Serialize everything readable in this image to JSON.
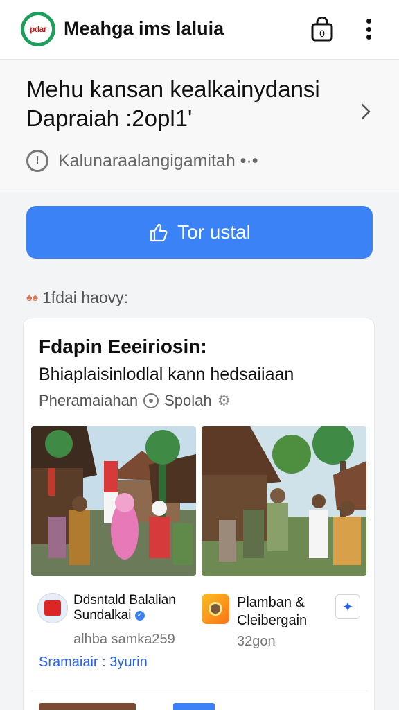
{
  "header": {
    "logo_text": "pdar",
    "title": "Meahga ims laluia",
    "bag_badge": "0"
  },
  "banner": {
    "title": "Mehu kansan kealkainydansi Dapraiah :2opl1'",
    "subtitle": "Kalunaraalangigamitah •·•"
  },
  "action_button": {
    "label": "Tor ustal"
  },
  "section": {
    "label": "1fdai haovy:"
  },
  "card": {
    "title": "Fdapin Eeeiriosin:",
    "description": "Bhiaplaisinlodlal kann hedsaiiaan",
    "meta_left": "Pheramaiahan",
    "meta_right": "Spolah",
    "items": [
      {
        "name": "Ddsntald Balalian Sundalkai",
        "sub": "alhba samka259",
        "link": "Sramaiair : 3yurin"
      },
      {
        "name": "Plamban & Cleibergain",
        "sub": "32gon"
      }
    ]
  },
  "colors": {
    "accent": "#3b82f6",
    "brand": "#1e9e5c",
    "link": "#2563eb"
  },
  "icons": [
    "bag-icon",
    "more-vert-icon",
    "chevron-right-icon",
    "info-icon",
    "thumbs-up-icon",
    "settings-icon",
    "verified-icon",
    "star-icon"
  ]
}
